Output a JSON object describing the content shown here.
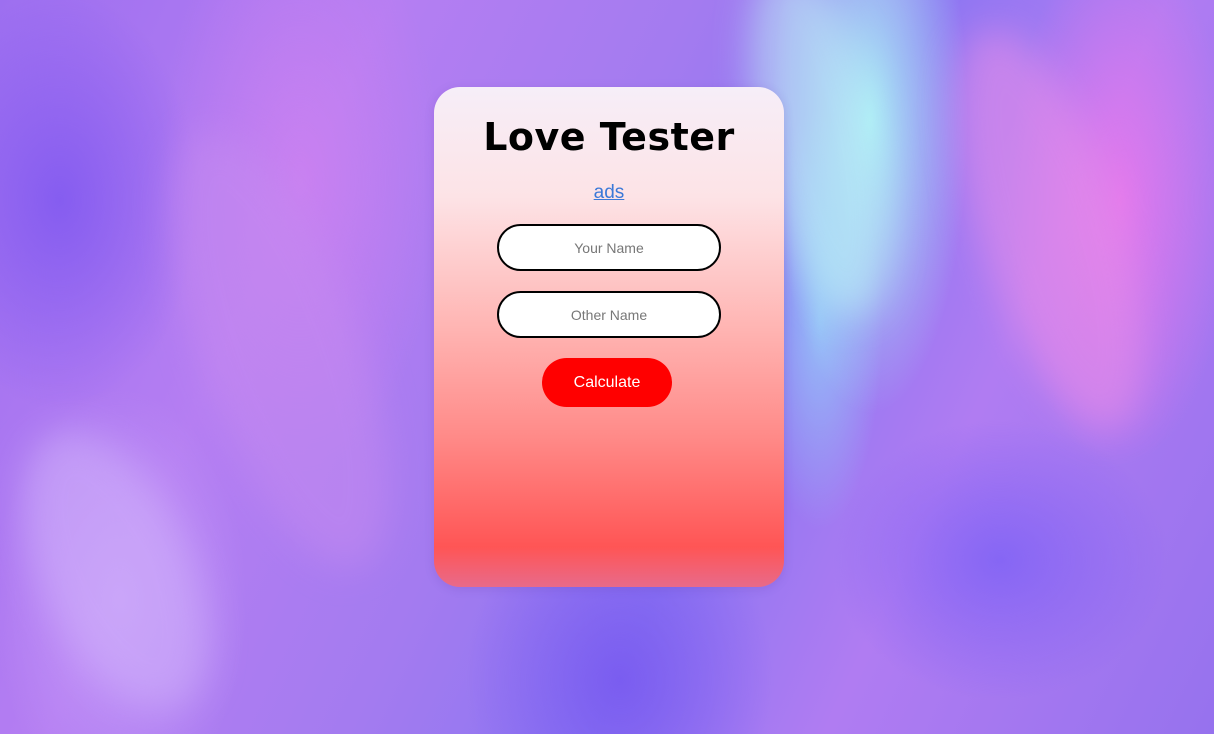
{
  "app": {
    "title": "Love Tester"
  },
  "links": {
    "ads_label": "ads"
  },
  "form": {
    "your_name_placeholder": "Your Name",
    "other_name_placeholder": "Other Name",
    "your_name_value": "",
    "other_name_value": "",
    "submit_label": "Calculate"
  },
  "colors": {
    "button": "#ff0000",
    "link": "#3b79d8",
    "card_top": "#f6eef8",
    "card_bottom": "#ff5555"
  }
}
